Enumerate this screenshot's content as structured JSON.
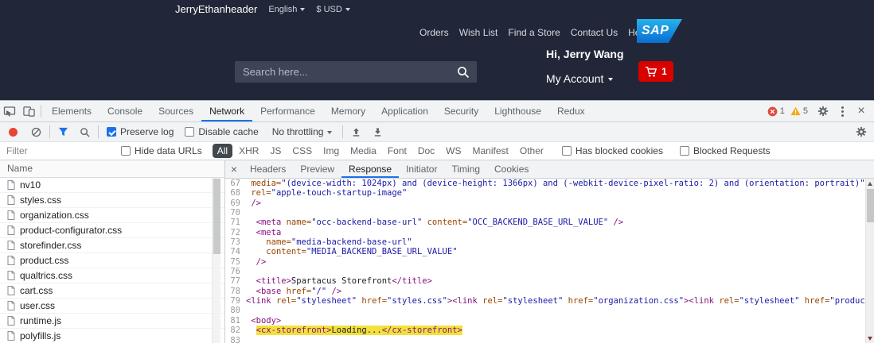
{
  "storefront": {
    "site_title": "JerryEthanheader",
    "language_selector": "English",
    "currency_selector": "$ USD",
    "nav_links": [
      "Orders",
      "Wish List",
      "Find a Store",
      "Contact Us",
      "Help"
    ],
    "logo_text": "SAP",
    "greeting": "Hi, Jerry Wang",
    "search_placeholder": "Search here...",
    "my_account_label": "My Account",
    "cart_count": "1"
  },
  "devtools": {
    "main_tabs": [
      "Elements",
      "Console",
      "Sources",
      "Network",
      "Performance",
      "Memory",
      "Application",
      "Security",
      "Lighthouse",
      "Redux"
    ],
    "active_main_tab": "Network",
    "error_count": "1",
    "warning_count": "5",
    "network_toolbar": {
      "preserve_log_label": "Preserve log",
      "preserve_log_checked": true,
      "disable_cache_label": "Disable cache",
      "disable_cache_checked": false,
      "throttling_label": "No throttling"
    },
    "filter_row": {
      "filter_placeholder": "Filter",
      "hide_data_urls_label": "Hide data URLs",
      "resource_types": [
        "All",
        "XHR",
        "JS",
        "CSS",
        "Img",
        "Media",
        "Font",
        "Doc",
        "WS",
        "Manifest",
        "Other"
      ],
      "active_resource_type": "All",
      "has_blocked_cookies_label": "Has blocked cookies",
      "blocked_requests_label": "Blocked Requests"
    },
    "request_list": {
      "header": "Name",
      "files": [
        "nv10",
        "styles.css",
        "organization.css",
        "product-configurator.css",
        "storefinder.css",
        "product.css",
        "qualtrics.css",
        "cart.css",
        "user.css",
        "runtime.js",
        "polyfills.js"
      ]
    },
    "response_pane": {
      "tabs": [
        "Headers",
        "Preview",
        "Response",
        "Initiator",
        "Timing",
        "Cookies"
      ],
      "active_tab": "Response",
      "code_lines": [
        {
          "num": "67",
          "indent": 1,
          "hl": false,
          "segs": [
            [
              "attr",
              "media="
            ],
            [
              "str",
              "\"(device-width: 1024px) and (device-height: 1366px) and (-webkit-device-pixel-ratio: 2) and (orientation: portrait)\""
            ]
          ]
        },
        {
          "num": "68",
          "indent": 1,
          "hl": false,
          "segs": [
            [
              "attr",
              "rel="
            ],
            [
              "str",
              "\"apple-touch-startup-image\""
            ]
          ]
        },
        {
          "num": "69",
          "indent": 1,
          "hl": false,
          "segs": [
            [
              "tag",
              "/>"
            ]
          ]
        },
        {
          "num": "70",
          "indent": 0,
          "hl": false,
          "segs": []
        },
        {
          "num": "71",
          "indent": 2,
          "hl": false,
          "segs": [
            [
              "tag",
              "<meta"
            ],
            [
              "plain",
              " "
            ],
            [
              "attr",
              "name="
            ],
            [
              "str",
              "\"occ-backend-base-url\""
            ],
            [
              "plain",
              " "
            ],
            [
              "attr",
              "content="
            ],
            [
              "str",
              "\"OCC_BACKEND_BASE_URL_VALUE\""
            ],
            [
              "plain",
              " "
            ],
            [
              "tag",
              "/>"
            ]
          ]
        },
        {
          "num": "72",
          "indent": 2,
          "hl": false,
          "segs": [
            [
              "tag",
              "<meta"
            ]
          ]
        },
        {
          "num": "73",
          "indent": 4,
          "hl": false,
          "segs": [
            [
              "attr",
              "name="
            ],
            [
              "str",
              "\"media-backend-base-url\""
            ]
          ]
        },
        {
          "num": "74",
          "indent": 4,
          "hl": false,
          "segs": [
            [
              "attr",
              "content="
            ],
            [
              "str",
              "\"MEDIA_BACKEND_BASE_URL_VALUE\""
            ]
          ]
        },
        {
          "num": "75",
          "indent": 2,
          "hl": false,
          "segs": [
            [
              "tag",
              "/>"
            ]
          ]
        },
        {
          "num": "76",
          "indent": 0,
          "hl": false,
          "segs": []
        },
        {
          "num": "77",
          "indent": 2,
          "hl": false,
          "segs": [
            [
              "tag",
              "<title>"
            ],
            [
              "plain",
              "Spartacus Storefront"
            ],
            [
              "tag",
              "</title>"
            ]
          ]
        },
        {
          "num": "78",
          "indent": 2,
          "hl": false,
          "segs": [
            [
              "tag",
              "<base"
            ],
            [
              "plain",
              " "
            ],
            [
              "attr",
              "href="
            ],
            [
              "str",
              "\"/\""
            ],
            [
              "plain",
              " "
            ],
            [
              "tag",
              "/>"
            ]
          ]
        },
        {
          "num": "79",
          "indent": 0,
          "hl": false,
          "segs": [
            [
              "tag",
              "<link"
            ],
            [
              "plain",
              " "
            ],
            [
              "attr",
              "rel="
            ],
            [
              "str",
              "\"stylesheet\""
            ],
            [
              "plain",
              " "
            ],
            [
              "attr",
              "href="
            ],
            [
              "str",
              "\"styles.css\""
            ],
            [
              "tag",
              "><link"
            ],
            [
              "plain",
              " "
            ],
            [
              "attr",
              "rel="
            ],
            [
              "str",
              "\"stylesheet\""
            ],
            [
              "plain",
              " "
            ],
            [
              "attr",
              "href="
            ],
            [
              "str",
              "\"organization.css\""
            ],
            [
              "tag",
              "><link"
            ],
            [
              "plain",
              " "
            ],
            [
              "attr",
              "rel="
            ],
            [
              "str",
              "\"stylesheet\""
            ],
            [
              "plain",
              " "
            ],
            [
              "attr",
              "href="
            ],
            [
              "str",
              "\"product-c"
            ]
          ]
        },
        {
          "num": "80",
          "indent": 0,
          "hl": false,
          "segs": []
        },
        {
          "num": "81",
          "indent": 1,
          "hl": false,
          "segs": [
            [
              "tag",
              "<body>"
            ]
          ]
        },
        {
          "num": "82",
          "indent": 2,
          "hl": true,
          "segs": [
            [
              "tag",
              "<cx-storefront>"
            ],
            [
              "plain",
              "Loading..."
            ],
            [
              "tag",
              "</cx-storefront>"
            ]
          ]
        },
        {
          "num": "83",
          "indent": 0,
          "hl": false,
          "segs": []
        }
      ]
    }
  },
  "icons": {
    "close_glyph": "×"
  },
  "colors": {
    "header_background": "#212738",
    "cart_red": "#d90000",
    "sap_blue": "#0a6ed1",
    "accent_blue": "#1a73e8",
    "error_red": "#e04a3f",
    "warning_yellow": "#f5a70a",
    "highlight_yellow": "#f2e13c",
    "syntax_tag": "#881280",
    "syntax_attr": "#994500",
    "syntax_string": "#1a1aa6"
  }
}
